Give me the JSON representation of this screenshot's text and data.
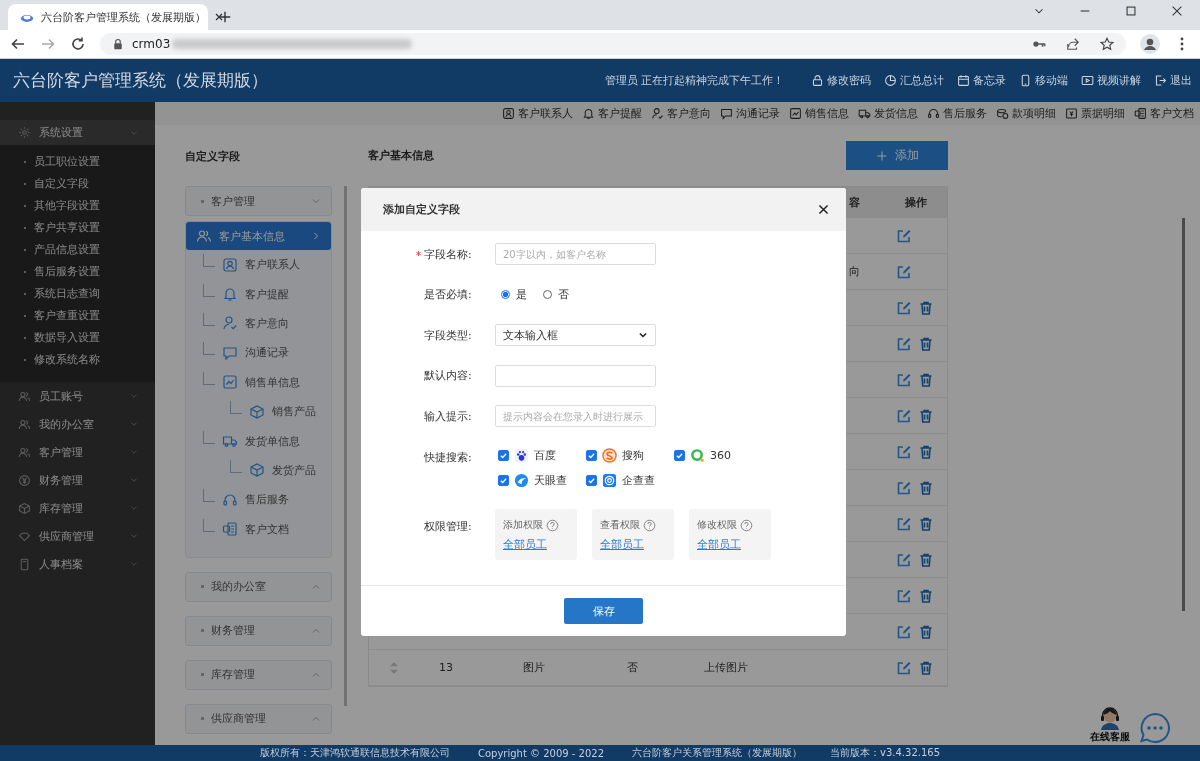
{
  "browser": {
    "tab_title": "六台阶客户管理系统（发展期版）",
    "url": "crm03"
  },
  "header": {
    "title": "六台阶客户管理系统（发展期版）",
    "greeting": "管理员 正在打起精神完成下午工作！",
    "links": [
      "修改密码",
      "汇总总计",
      "备忘录",
      "移动端",
      "视频讲解",
      "退出"
    ]
  },
  "quick_links": [
    "客户联系人",
    "客户提醒",
    "客户意向",
    "沟通记录",
    "销售信息",
    "发货信息",
    "售后服务",
    "款项明细",
    "票据明细",
    "客户文档"
  ],
  "sidebar": {
    "groups": [
      {
        "label": "系统设置",
        "children": [
          "员工职位设置",
          "自定义字段",
          "其他字段设置",
          "客户共享设置",
          "产品信息设置",
          "售后服务设置",
          "系统日志查询",
          "客户查重设置",
          "数据导入设置",
          "修改系统名称"
        ]
      },
      {
        "label": "员工账号"
      },
      {
        "label": "我的办公室"
      },
      {
        "label": "客户管理"
      },
      {
        "label": "财务管理"
      },
      {
        "label": "库存管理"
      },
      {
        "label": "供应商管理"
      },
      {
        "label": "人事档案"
      }
    ]
  },
  "page": {
    "title": "自定义字段",
    "tree_groups": [
      {
        "label": "客户管理",
        "expanded": true,
        "items": [
          {
            "label": "客户基本信息",
            "selected": true,
            "children": [
              {
                "label": "客户联系人",
                "selected": false
              },
              {
                "label": "客户提醒",
                "selected": false
              },
              {
                "label": "客户意向",
                "selected": false
              },
              {
                "label": "沟通记录",
                "selected": false
              },
              {
                "label": "销售单信息",
                "selected": false,
                "children": [
                  {
                    "label": "销售产品",
                    "selected": false
                  }
                ]
              },
              {
                "label": "发货单信息",
                "selected": false,
                "children": [
                  {
                    "label": "发货产品",
                    "selected": false
                  }
                ]
              },
              {
                "label": "售后服务",
                "selected": false
              },
              {
                "label": "客户文档",
                "selected": false
              }
            ]
          }
        ]
      },
      {
        "label": "我的办公室",
        "expanded": false
      },
      {
        "label": "财务管理",
        "expanded": false
      },
      {
        "label": "库存管理",
        "expanded": false
      },
      {
        "label": "供应商管理",
        "expanded": false
      }
    ]
  },
  "table": {
    "title": "客户基本信息",
    "add_button": "添加",
    "header": {
      "column_6": "容",
      "column_7": "操作"
    },
    "rows": [
      {
        "deletable": false
      },
      {
        "column_6": "向",
        "deletable": false
      },
      {
        "deletable": true
      },
      {
        "deletable": true
      },
      {
        "deletable": true
      },
      {
        "deletable": true
      },
      {
        "deletable": true
      },
      {
        "deletable": true
      },
      {
        "deletable": true
      },
      {
        "deletable": true
      },
      {
        "deletable": true
      },
      {
        "deletable": true
      },
      {
        "column_2": "13",
        "column_3": "图片",
        "column_4": "否",
        "column_5": "上传图片",
        "deletable": true
      }
    ]
  },
  "dialog": {
    "title": "添加自定义字段",
    "save_button": "保存",
    "fields": [
      {
        "kind": "text",
        "label": "字段名称:",
        "required": true,
        "placeholder": "20字以内，如客户名称"
      },
      {
        "kind": "radio",
        "label": "是否必填:",
        "required": false,
        "options": [
          {
            "label": "是",
            "selected": true
          },
          {
            "label": "否",
            "selected": false
          }
        ]
      },
      {
        "kind": "select",
        "label": "字段类型:",
        "required": false,
        "value": "文本输入框"
      },
      {
        "kind": "text",
        "label": "默认内容:",
        "required": false
      },
      {
        "kind": "text",
        "label": "输入提示:",
        "required": false,
        "placeholder": "提示内容会在您录入时进行展示"
      },
      {
        "kind": "checks",
        "label": "快捷搜索:",
        "required": false,
        "options": [
          {
            "label": "百度",
            "checked": true
          },
          {
            "label": "搜狗",
            "checked": true
          },
          {
            "label": "360",
            "checked": true
          },
          {
            "label": "天眼查",
            "checked": true
          },
          {
            "label": "企查查",
            "checked": true
          }
        ]
      },
      {
        "kind": "perms",
        "label": "权限管理:",
        "required": false,
        "cards": [
          {
            "label": "添加权限",
            "value": "全部员工"
          },
          {
            "label": "查看权限",
            "value": "全部员工"
          },
          {
            "label": "修改权限",
            "value": "全部员工"
          }
        ]
      }
    ]
  },
  "support": {
    "label": "在线客服"
  },
  "footer": [
    "版权所有：天津鸿软通联信息技术有限公司",
    "Copyright © 2009 - 2022",
    "六台阶客户关系管理系统（发展期版）",
    "当前版本：v3.4.32.165"
  ]
}
